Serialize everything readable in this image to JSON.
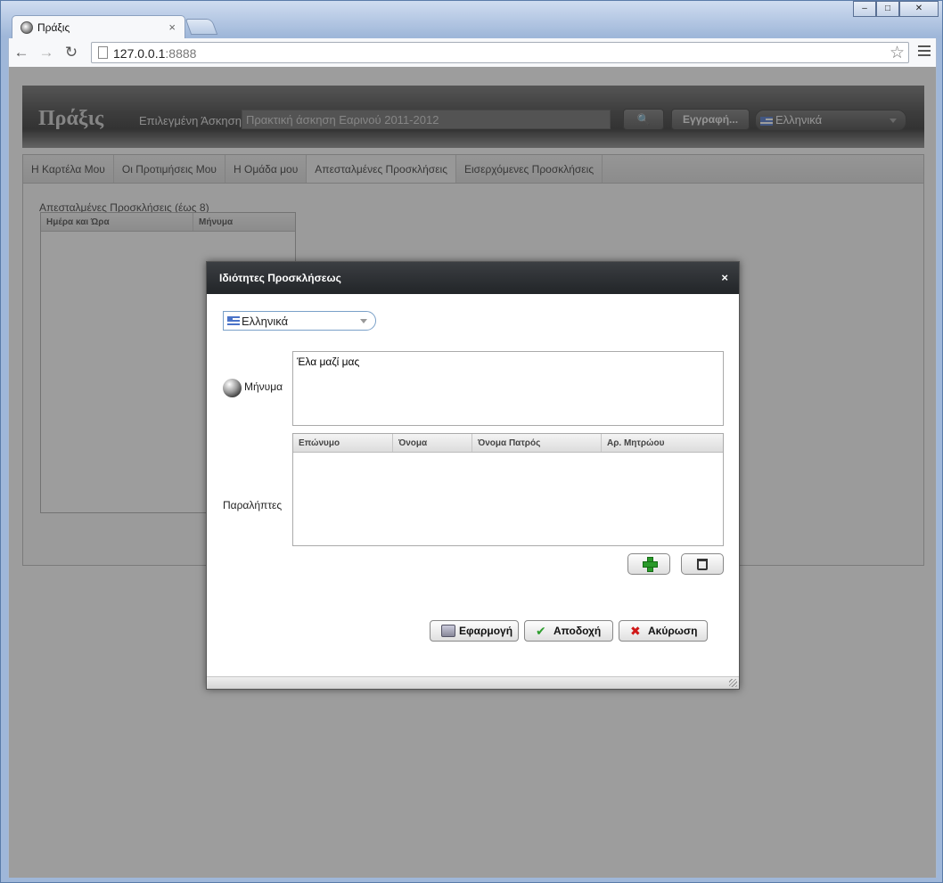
{
  "browser": {
    "tab_title": "Πράξις",
    "tab_close": "×",
    "url_host": "127.0.0.1",
    "url_port": ":8888",
    "window_controls": [
      "–",
      "□",
      "✕"
    ]
  },
  "header": {
    "brand": "Πράξις",
    "selected_label": "Επιλεγμένη Άσκηση",
    "selected_value": "Πρακτική άσκηση Εαρινού 2011-2012",
    "register_label": "Εγγραφή...",
    "language": "Ελληνικά"
  },
  "tabs": [
    {
      "label": "Η Καρτέλα Μου"
    },
    {
      "label": "Οι Προτιμήσεις Μου"
    },
    {
      "label": "Η Ομάδα μου"
    },
    {
      "label": "Απεσταλμένες Προσκλήσεις"
    },
    {
      "label": "Εισερχόμενες Προσκλήσεις"
    }
  ],
  "sent_grid": {
    "title": "Απεσταλμένες Προσκλήσεις (έως 8)",
    "columns": [
      "Ημέρα και Ώρα",
      "Μήνυμα"
    ]
  },
  "dialog": {
    "title": "Ιδιότητες Προσκλήσεως",
    "close": "×",
    "language": "Ελληνικά",
    "message_label": "Μήνυμα",
    "message_value": "Έλα μαζί μας",
    "recipients_label": "Παραλήπτες",
    "columns": [
      "Επώνυμο",
      "Όνομα",
      "Όνομα Πατρός",
      "Αρ. Μητρώου"
    ],
    "apply_label": "Εφαρμογή",
    "accept_label": "Αποδοχή",
    "cancel_label": "Ακύρωση"
  },
  "colors": {
    "accept_check": "#2e9e2e",
    "cancel_x": "#d01818",
    "add_plus": "#2a9a2a"
  }
}
